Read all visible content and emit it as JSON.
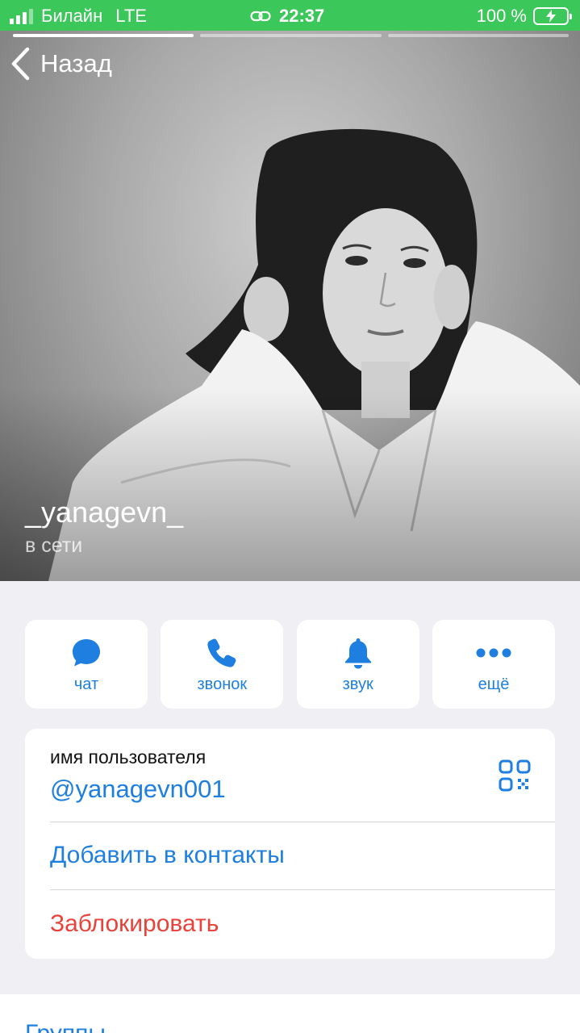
{
  "status_bar": {
    "carrier": "Билайн",
    "network": "LTE",
    "time": "22:37",
    "battery": "100 %",
    "bg_color": "#3cc75a"
  },
  "header": {
    "back_label": "Назад",
    "stories_total": 3,
    "stories_active_index": 0
  },
  "profile": {
    "display_name": "_yanagevn_",
    "status": "в сети"
  },
  "actions": [
    {
      "label": "чат",
      "icon": "chat-bubble-icon"
    },
    {
      "label": "звонок",
      "icon": "phone-icon"
    },
    {
      "label": "звук",
      "icon": "bell-icon"
    },
    {
      "label": "ещё",
      "icon": "more-dots-icon"
    }
  ],
  "info": {
    "username_label": "имя пользователя",
    "username": "@yanagevn001",
    "add_contact": "Добавить в контакты",
    "block": "Заблокировать"
  },
  "bottom": {
    "groups_label": "Группы"
  },
  "colors": {
    "accent": "#1e7fe0",
    "danger": "#e8423a",
    "background": "#efeff4"
  }
}
